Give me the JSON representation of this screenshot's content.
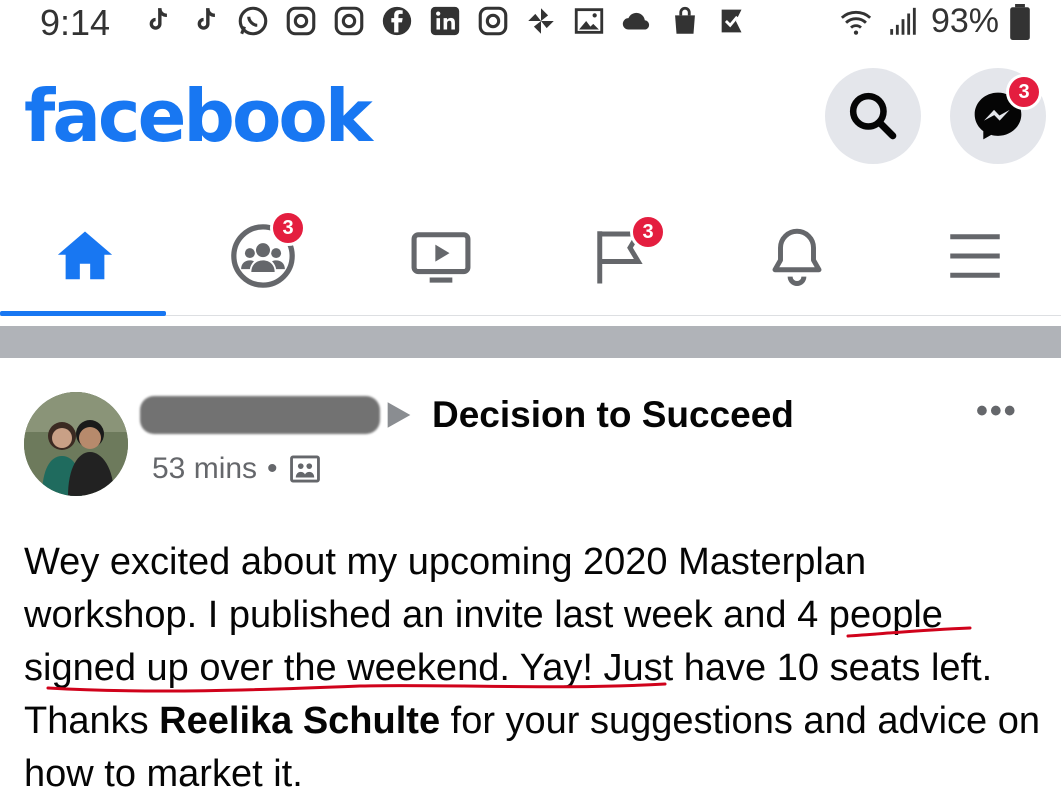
{
  "status_bar": {
    "time": "9:14",
    "battery": "93%"
  },
  "header": {
    "logo": "facebook",
    "messenger_badge": "3"
  },
  "nav": {
    "tabs": [
      {
        "name": "home",
        "icon": "home-icon",
        "active": true
      },
      {
        "name": "groups",
        "icon": "groups-icon",
        "badge": "3"
      },
      {
        "name": "watch",
        "icon": "video-icon"
      },
      {
        "name": "pages",
        "icon": "flag-icon",
        "badge": "3"
      },
      {
        "name": "notifications",
        "icon": "bell-icon"
      },
      {
        "name": "menu",
        "icon": "hamburger-icon"
      }
    ]
  },
  "post": {
    "group_name": "Decision to Succeed",
    "time": "53 mins",
    "more": "•••",
    "body": {
      "part1": "Wey excited about my upcoming 2020 Masterplan workshop.  I published an invite last week and 4 people signed up over the weekend. Yay!  Just have 10 seats left.   Thanks ",
      "mention": "Reelika Schulte",
      "part2": " for your suggestions and advice on how to market it."
    }
  },
  "colors": {
    "brand": "#1877f2",
    "badge": "#e41e3f",
    "muted": "#65676b",
    "annotation": "#d0021b"
  }
}
